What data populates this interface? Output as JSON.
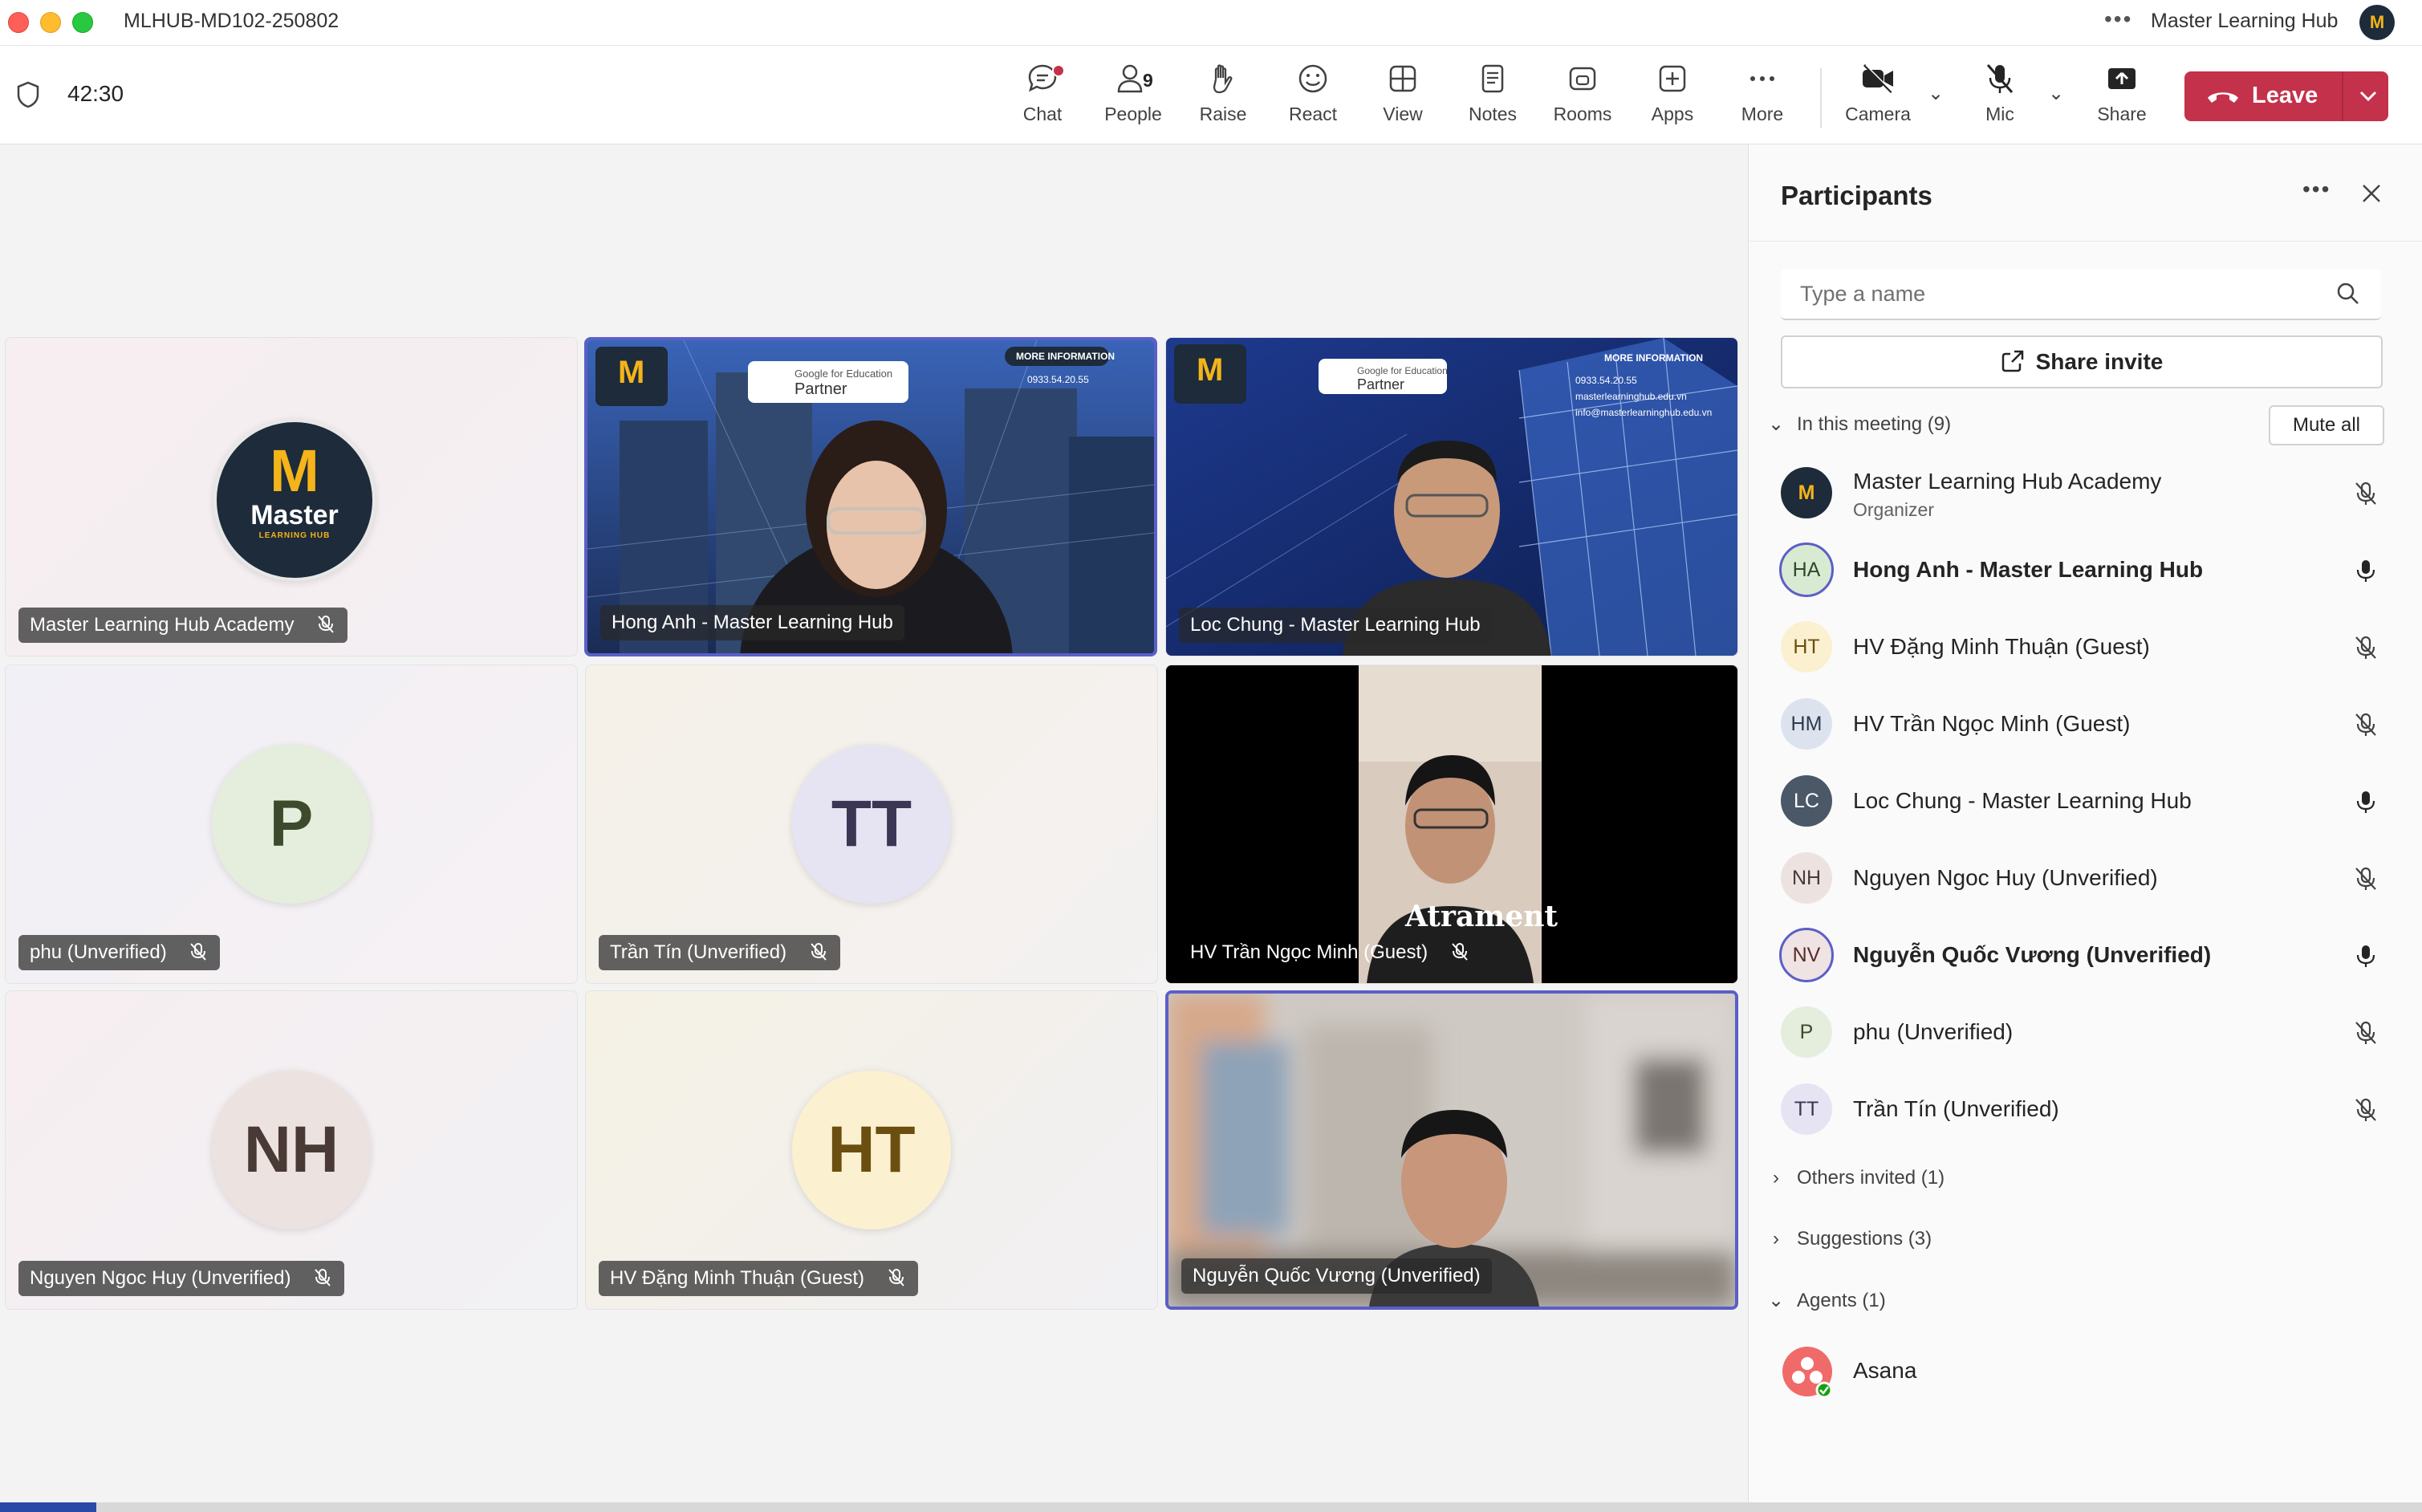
{
  "window": {
    "title": "MLHUB-MD102-250802",
    "org_name": "Master Learning Hub",
    "avatar_text": "M"
  },
  "toolbar": {
    "timer": "42:30",
    "people_count": "9",
    "buttons": {
      "chat": "Chat",
      "people": "People",
      "raise": "Raise",
      "react": "React",
      "view": "View",
      "notes": "Notes",
      "rooms": "Rooms",
      "apps": "Apps",
      "more": "More",
      "camera": "Camera",
      "mic": "Mic",
      "share": "Share"
    },
    "leave_label": "Leave"
  },
  "stage": {
    "tiles": [
      {
        "name": "Master Learning Hub Academy",
        "type": "logo",
        "muted": true
      },
      {
        "name": "Hong Anh - Master Learning Hub",
        "type": "video",
        "muted": false,
        "active": true
      },
      {
        "name": "Loc Chung - Master Learning Hub",
        "type": "video",
        "muted": false
      },
      {
        "name": "phu (Unverified)",
        "type": "avatar",
        "initials": "P",
        "muted": true
      },
      {
        "name": "Trần Tín (Unverified)",
        "type": "avatar",
        "initials": "TT",
        "muted": true
      },
      {
        "name": "HV Trần Ngọc Minh (Guest)",
        "type": "video",
        "muted": true
      },
      {
        "name": "Nguyen Ngoc Huy (Unverified)",
        "type": "avatar",
        "initials": "NH",
        "muted": true
      },
      {
        "name": "HV Đặng Minh Thuận (Guest)",
        "type": "avatar",
        "initials": "HT",
        "muted": true
      },
      {
        "name": "Nguyễn Quốc Vương (Unverified)",
        "type": "video",
        "muted": false,
        "active": true
      }
    ],
    "logo_text": {
      "mark": "M",
      "word": "Master",
      "sub": "LEARNING HUB"
    },
    "video_overlay": {
      "info_title": "MORE INFORMATION",
      "gfe_small": "Google for Education",
      "gfe_big": "Partner",
      "phone": "0933.54.20.55",
      "web": "masterlearninghub.edu.vn",
      "email": "info@masterlearninghub.edu.vn",
      "shirt_text": "Atrament"
    }
  },
  "panel": {
    "title": "Participants",
    "search_placeholder": "Type a name",
    "share_invite": "Share invite",
    "in_meeting_label": "In this meeting (9)",
    "mute_all": "Mute all",
    "participants": [
      {
        "initials": "M",
        "name": "Master Learning Hub Academy",
        "role": "Organizer",
        "mic": "muted",
        "avatar_bg": "#1d2b3a"
      },
      {
        "initials": "HA",
        "name": "Hong Anh - Master Learning Hub",
        "mic": "on",
        "bold": true,
        "avatar_bg": "#d9ead3"
      },
      {
        "initials": "HT",
        "name": "HV Đặng Minh Thuận (Guest)",
        "mic": "muted",
        "avatar_bg": "#fbf0cf"
      },
      {
        "initials": "HM",
        "name": "HV Trần Ngọc Minh (Guest)",
        "mic": "muted",
        "avatar_bg": "#dde3ee"
      },
      {
        "initials": "LC",
        "name": "Loc Chung - Master Learning Hub",
        "mic": "on",
        "avatar_bg": "#4a5868"
      },
      {
        "initials": "NH",
        "name": "Nguyen Ngoc Huy (Unverified)",
        "mic": "muted",
        "avatar_bg": "#ece3e0"
      },
      {
        "initials": "NV",
        "name": "Nguyễn Quốc Vương (Unverified)",
        "mic": "on",
        "bold": true,
        "avatar_bg": "#efe3e3"
      },
      {
        "initials": "P",
        "name": "phu (Unverified)",
        "mic": "muted",
        "avatar_bg": "#e5eedd"
      },
      {
        "initials": "TT",
        "name": "Trần Tín (Unverified)",
        "mic": "muted",
        "avatar_bg": "#e6e4f2"
      }
    ],
    "others_invited": "Others invited (1)",
    "suggestions": "Suggestions (3)",
    "agents": "Agents (1)",
    "agent_name": "Asana"
  },
  "colors": {
    "accent": "#5b5fc7",
    "leave": "#c4314b",
    "logo_navy": "#1d2b3a",
    "logo_gold": "#f4b41a"
  }
}
